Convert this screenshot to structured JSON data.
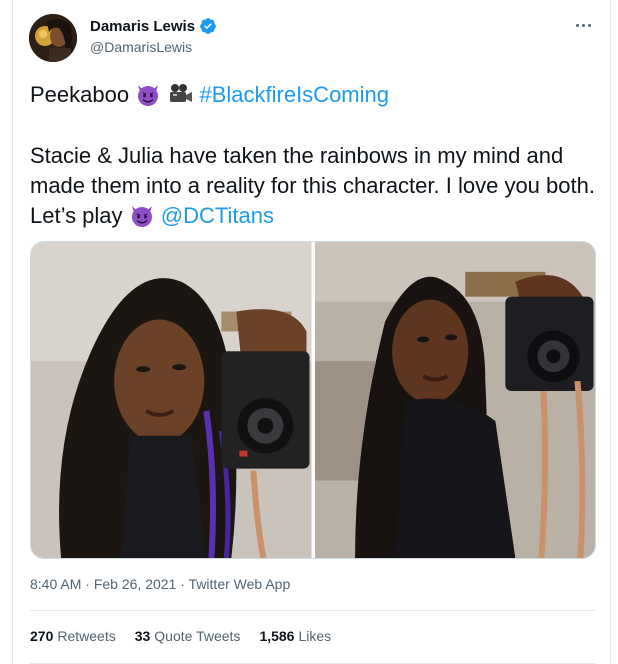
{
  "author": {
    "name": "Damaris Lewis",
    "handle": "@DamarisLewis",
    "verified": true
  },
  "tweet": {
    "line1_text": "Peekaboo",
    "line1_hashtag": "#BlackfireIsComing",
    "body_text": "Stacie & Julia have taken the rainbows in my mind and made them into a reality for this character. I love you both. Let’s play",
    "mention": "@DCTitans",
    "emojis": [
      "smiling-imp-emoji",
      "movie-camera-emoji",
      "smiling-imp-emoji"
    ]
  },
  "media": {
    "photos": [
      "photo-1",
      "photo-2"
    ]
  },
  "meta": {
    "time": "8:40 AM",
    "separator": "·",
    "date": "Feb 26, 2021",
    "source": "Twitter Web App"
  },
  "stats": {
    "retweets_count": "270",
    "retweets_label": "Retweets",
    "quotes_count": "33",
    "quotes_label": "Quote Tweets",
    "likes_count": "1,586",
    "likes_label": "Likes"
  },
  "colors": {
    "link": "#1d9bf0",
    "text": "#0f1419",
    "secondary": "#536471",
    "verified": "#1d9bf0",
    "border": "#e1e8ed"
  }
}
